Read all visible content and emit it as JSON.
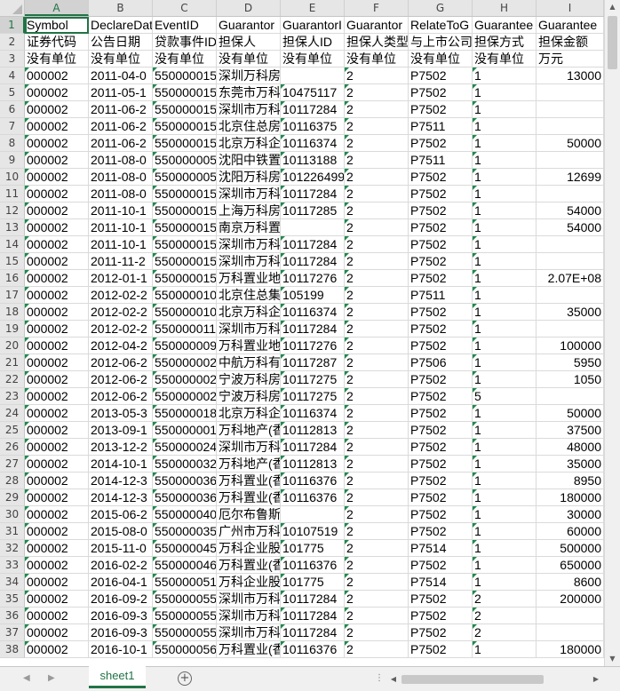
{
  "spreadsheet": {
    "columns": [
      "A",
      "B",
      "C",
      "D",
      "E",
      "F",
      "G",
      "H",
      "I"
    ],
    "row_numbers": [
      "1",
      "2",
      "3",
      "4",
      "5",
      "6",
      "7",
      "8",
      "9",
      "10",
      "11",
      "12",
      "13",
      "14",
      "15",
      "16",
      "17",
      "18",
      "19",
      "20",
      "21",
      "22",
      "23",
      "24",
      "25",
      "26",
      "27",
      "28",
      "29",
      "30",
      "31",
      "32",
      "33",
      "34",
      "35",
      "36",
      "37",
      "38"
    ],
    "rows": [
      [
        "Symbol",
        "DeclareDat",
        "EventID",
        "Guarantor",
        "GuarantorI",
        "Guarantor",
        "RelateToG",
        "Guarantee",
        "Guarantee"
      ],
      [
        "证券代码",
        "公告日期",
        "贷款事件ID",
        "担保人",
        "担保人ID",
        "担保人类型",
        "与上市公司",
        "担保方式",
        "担保金额"
      ],
      [
        "没有单位",
        "没有单位",
        "没有单位",
        "没有单位",
        "没有单位",
        "没有单位",
        "没有单位",
        "没有单位",
        "万元"
      ],
      [
        "000002",
        "2011-04-0",
        "550000015",
        "深圳万科房地产有限公司",
        "",
        "2",
        "P7502",
        "1",
        "13000"
      ],
      [
        "000002",
        "2011-05-1",
        "550000015",
        "东莞市万科",
        "10475117",
        "2",
        "P7502",
        "1",
        ""
      ],
      [
        "000002",
        "2011-06-2",
        "550000015",
        "深圳市万科",
        "10117284",
        "2",
        "P7502",
        "1",
        ""
      ],
      [
        "000002",
        "2011-06-2",
        "550000015",
        "北京住总房",
        "10116375",
        "2",
        "P7511",
        "1",
        ""
      ],
      [
        "000002",
        "2011-06-2",
        "550000015",
        "北京万科企",
        "10116374",
        "2",
        "P7502",
        "1",
        "50000"
      ],
      [
        "000002",
        "2011-08-0",
        "550000005",
        "沈阳中铁置",
        "10113188",
        "2",
        "P7511",
        "1",
        ""
      ],
      [
        "000002",
        "2011-08-0",
        "550000005",
        "沈阳万科房",
        "101226499",
        "2",
        "P7502",
        "1",
        "12699"
      ],
      [
        "000002",
        "2011-08-0",
        "550000015",
        "深圳市万科",
        "10117284",
        "2",
        "P7502",
        "1",
        ""
      ],
      [
        "000002",
        "2011-10-1",
        "550000015",
        "上海万科房",
        "10117285",
        "2",
        "P7502",
        "1",
        "54000"
      ],
      [
        "000002",
        "2011-10-1",
        "550000015",
        "南京万科置业有限公司",
        "",
        "2",
        "P7502",
        "1",
        "54000"
      ],
      [
        "000002",
        "2011-10-1",
        "550000015",
        "深圳市万科",
        "10117284",
        "2",
        "P7502",
        "1",
        ""
      ],
      [
        "000002",
        "2011-11-2",
        "550000015",
        "深圳市万科",
        "10117284",
        "2",
        "P7502",
        "1",
        ""
      ],
      [
        "000002",
        "2012-01-1",
        "550000015",
        "万科置业地",
        "10117276",
        "2",
        "P7502",
        "1",
        "2.07E+08"
      ],
      [
        "000002",
        "2012-02-2",
        "550000010",
        "北京住总集",
        "105199",
        "2",
        "P7511",
        "1",
        ""
      ],
      [
        "000002",
        "2012-02-2",
        "550000010",
        "北京万科企",
        "10116374",
        "2",
        "P7502",
        "1",
        "35000"
      ],
      [
        "000002",
        "2012-02-2",
        "550000011",
        "深圳市万科",
        "10117284",
        "2",
        "P7502",
        "1",
        ""
      ],
      [
        "000002",
        "2012-04-2",
        "550000009",
        "万科置业地",
        "10117276",
        "2",
        "P7502",
        "1",
        "100000"
      ],
      [
        "000002",
        "2012-06-2",
        "550000002",
        "中航万科有",
        "10117287",
        "2",
        "P7506",
        "1",
        "5950"
      ],
      [
        "000002",
        "2012-06-2",
        "550000002",
        "宁波万科房",
        "10117275",
        "2",
        "P7502",
        "1",
        "1050"
      ],
      [
        "000002",
        "2012-06-2",
        "550000002",
        "宁波万科房",
        "10117275",
        "2",
        "P7502",
        "5",
        ""
      ],
      [
        "000002",
        "2013-05-3",
        "550000018",
        "北京万科企",
        "10116374",
        "2",
        "P7502",
        "1",
        "50000"
      ],
      [
        "000002",
        "2013-09-1",
        "550000001",
        "万科地产(香",
        "10112813",
        "2",
        "P7502",
        "1",
        "37500"
      ],
      [
        "000002",
        "2013-12-2",
        "550000024",
        "深圳市万科",
        "10117284",
        "2",
        "P7502",
        "1",
        "48000"
      ],
      [
        "000002",
        "2014-10-1",
        "550000032",
        "万科地产(香",
        "10112813",
        "2",
        "P7502",
        "1",
        "35000"
      ],
      [
        "000002",
        "2014-12-3",
        "550000036",
        "万科置业(香",
        "10116376",
        "2",
        "P7502",
        "1",
        "8950"
      ],
      [
        "000002",
        "2014-12-3",
        "550000036",
        "万科置业(香",
        "10116376",
        "2",
        "P7502",
        "1",
        "180000"
      ],
      [
        "000002",
        "2015-06-2",
        "550000040",
        "厄尔布鲁斯投资有限公司",
        "",
        "2",
        "P7502",
        "1",
        "30000"
      ],
      [
        "000002",
        "2015-08-0",
        "550000035",
        "广州市万科",
        "10107519",
        "2",
        "P7502",
        "1",
        "60000"
      ],
      [
        "000002",
        "2015-11-0",
        "550000045",
        "万科企业股",
        "101775",
        "2",
        "P7514",
        "1",
        "500000"
      ],
      [
        "000002",
        "2016-02-2",
        "550000046",
        "万科置业(香",
        "10116376",
        "2",
        "P7502",
        "1",
        "650000"
      ],
      [
        "000002",
        "2016-04-1",
        "550000051",
        "万科企业股",
        "101775",
        "2",
        "P7514",
        "1",
        "8600"
      ],
      [
        "000002",
        "2016-09-2",
        "550000055",
        "深圳市万科",
        "10117284",
        "2",
        "P7502",
        "2",
        "200000"
      ],
      [
        "000002",
        "2016-09-3",
        "550000055",
        "深圳市万科",
        "10117284",
        "2",
        "P7502",
        "2",
        ""
      ],
      [
        "000002",
        "2016-09-3",
        "550000055",
        "深圳市万科",
        "10117284",
        "2",
        "P7502",
        "2",
        ""
      ],
      [
        "000002",
        "2016-10-1",
        "550000056",
        "万科置业(香",
        "10116376",
        "2",
        "P7502",
        "1",
        "180000"
      ]
    ]
  },
  "sheet_tabs": [
    "sheet1"
  ],
  "icons": {
    "add_sheet": "plus-circle-icon",
    "nav_prev": "triangle-left-icon",
    "nav_next": "triangle-right-icon",
    "more": "ellipsis-icon"
  },
  "colors": {
    "accent": "#217346",
    "error_indicator": "#1e8a4c",
    "header_bg": "#e6e6e6",
    "gridline": "#dadada"
  }
}
